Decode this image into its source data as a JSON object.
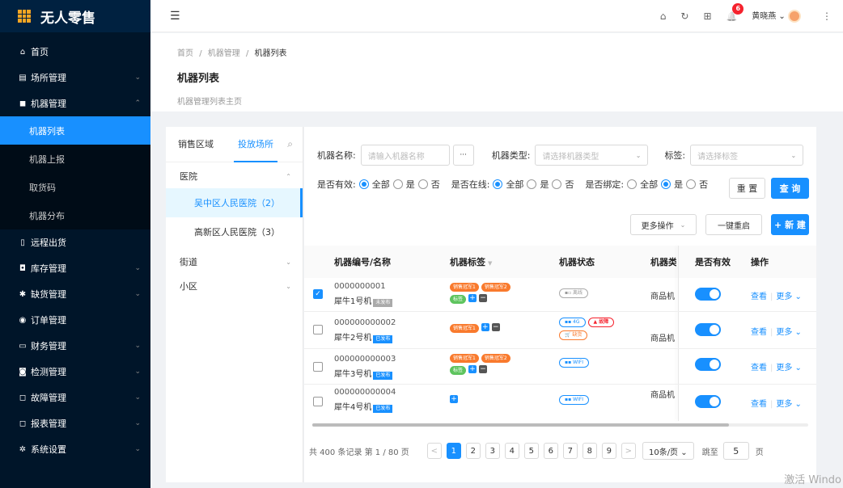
{
  "app": {
    "title": "无人零售"
  },
  "sidebar": {
    "items": [
      {
        "label": "首页",
        "icon": "home-icon",
        "glyph": "⌂"
      },
      {
        "label": "场所管理",
        "icon": "store-icon",
        "glyph": "▤",
        "chev": "⌄"
      },
      {
        "label": "机器管理",
        "icon": "machine-icon",
        "glyph": "◼",
        "chev": "⌃"
      }
    ],
    "sub_items": [
      "机器列表",
      "机器上报",
      "取货码",
      "机器分布"
    ],
    "items2": [
      {
        "label": "远程出货",
        "icon": "remote-icon",
        "glyph": "▯"
      },
      {
        "label": "库存管理",
        "icon": "inventory-icon",
        "glyph": "◘",
        "chev": "⌄"
      },
      {
        "label": "缺货管理",
        "icon": "shortage-icon",
        "glyph": "✱",
        "chev": "⌄"
      },
      {
        "label": "订单管理",
        "icon": "order-icon",
        "glyph": "◉"
      },
      {
        "label": "财务管理",
        "icon": "finance-icon",
        "glyph": "▭",
        "chev": "⌄"
      },
      {
        "label": "检测管理",
        "icon": "detect-icon",
        "glyph": "◙",
        "chev": "⌄"
      },
      {
        "label": "故障管理",
        "icon": "fault-icon",
        "glyph": "◻",
        "chev": "⌄"
      },
      {
        "label": "报表管理",
        "icon": "report-icon",
        "glyph": "◻",
        "chev": "⌄"
      },
      {
        "label": "系统设置",
        "icon": "settings-icon",
        "glyph": "✲",
        "chev": "⌄"
      }
    ]
  },
  "header": {
    "menu_glyph": "☰",
    "home_glyph": "⌂",
    "refresh_glyph": "↻",
    "grid_glyph": "⊞",
    "bell_glyph": "🔔",
    "notif_count": "6",
    "user": "黄晓燕",
    "user_chev": "⌄",
    "more_glyph": "⋮"
  },
  "breadcrumb": {
    "home": "首页",
    "sep": "/",
    "section": "机器管理",
    "current": "机器列表"
  },
  "page": {
    "title": "机器列表",
    "desc": "机器管理列表主页"
  },
  "left_panel": {
    "tabs": [
      "销售区域",
      "投放场所"
    ],
    "search_glyph": "⌕",
    "groups": [
      {
        "label": "医院",
        "chev": "⌃"
      },
      {
        "label": "街道",
        "chev": "⌄"
      },
      {
        "label": "小区",
        "chev": "⌄"
      }
    ],
    "hospital_items": [
      "吴中区人民医院（2）",
      "高新区人民医院（3）"
    ]
  },
  "filters": {
    "name_label": "机器名称:",
    "name_placeholder": "请输入机器名称",
    "ellipsis": "···",
    "type_label": "机器类型:",
    "type_placeholder": "请选择机器类型",
    "tag_label": "标签:",
    "tag_placeholder": "请选择标签",
    "select_chev": "⌄",
    "valid_label": "是否有效:",
    "online_label": "是否在线:",
    "bind_label": "是否绑定:",
    "opt_all": "全部",
    "opt_yes": "是",
    "opt_no": "否",
    "reset": "重 置",
    "query": "查 询"
  },
  "actions": {
    "more_ops": "更多操作",
    "reboot": "一键重启",
    "new": "+ 新 建"
  },
  "table": {
    "headers": [
      "机器编号/名称",
      "机器标签",
      "机器状态",
      "机器类型",
      "是否有效",
      "操作"
    ],
    "filter_glyph": "▼",
    "tag_sale1": "销售冠军1",
    "tag_sale2": "销售冠军2",
    "tag_label": "标签",
    "rows": [
      {
        "id": "0000000001",
        "name": "犀牛1号机",
        "pub": "未发布",
        "type": "商品机",
        "status": [
          "离线"
        ]
      },
      {
        "id": "000000000002",
        "name": "犀牛2号机",
        "pub": "已发布",
        "type": "商品机",
        "status": [
          "4G",
          "故障",
          "缺货"
        ]
      },
      {
        "id": "000000000003",
        "name": "犀牛3号机",
        "pub": "已发布",
        "type": "",
        "status": [
          "WIFI"
        ]
      },
      {
        "id": "000000000004",
        "name": "犀牛4号机",
        "pub": "已发布",
        "type": "商品机",
        "status": [
          "WIFI"
        ]
      }
    ],
    "view": "查看",
    "more": "更多 ⌄",
    "sep": "|"
  },
  "pagination": {
    "summary": "共 400 条记录 第 1 / 80 页",
    "prev": "<",
    "next": ">",
    "pages": [
      "1",
      "2",
      "3",
      "4",
      "5",
      "6",
      "7",
      "8",
      "9"
    ],
    "size": "10条/页 ⌄",
    "goto": "跳至",
    "goto_value": "5",
    "page_unit": "页"
  },
  "watermark": "激活 Windo",
  "colors": {
    "primary": "#1890ff",
    "sidebar": "#001529",
    "tag_orange": "#f97a2d",
    "tag_green": "#5ec45e",
    "danger": "#f5222d"
  }
}
